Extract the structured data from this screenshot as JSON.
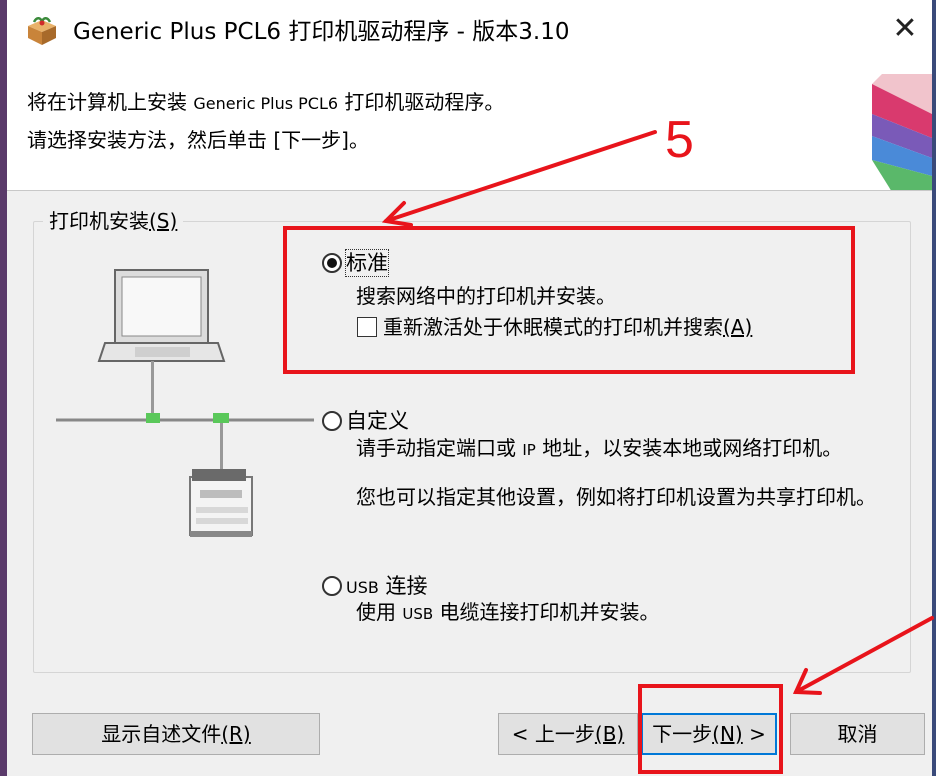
{
  "window": {
    "title": "Generic Plus PCL6 打印机驱动程序 - 版本3.10",
    "close_glyph": "✕"
  },
  "header": {
    "line1_prefix": "将在计算机上安装 ",
    "line1_product": "Generic Plus PCL6",
    "line1_suffix": " 打印机驱动程序。",
    "line2": "请选择安装方法，然后单击 [下一步]。"
  },
  "group": {
    "label": "打印机安装",
    "accel": "(S)"
  },
  "options": [
    {
      "label": "标准",
      "selected": true,
      "description": "搜索网络中的打印机并安装。",
      "checkbox": {
        "label": "重新激活处于休眠模式的打印机并搜索",
        "accel": "(A)",
        "checked": false
      }
    },
    {
      "label": "自定义",
      "selected": false,
      "description_a": "请手动指定端口或 ",
      "description_b": "IP",
      "description_c": " 地址，以安装本地或网络打印机。",
      "description2": "您也可以指定其他设置，例如将打印机设置为共享打印机。"
    },
    {
      "label_a": "USB",
      "label_b": " 连接",
      "selected": false,
      "description_a": "使用 ",
      "description_b": "USB",
      "description_c": " 电缆连接打印机并安装。"
    }
  ],
  "buttons": {
    "readme": "显示自述文件",
    "readme_accel": "(R)",
    "back": "< 上一步",
    "back_accel": "(B)",
    "next": "下一步",
    "next_accel": "(N)",
    "next_suffix": " >",
    "cancel": "取消"
  },
  "annotation": {
    "step_number": "5",
    "color": "#e8141b"
  },
  "icons": {
    "app": "installer-box-icon",
    "close": "close-icon"
  }
}
